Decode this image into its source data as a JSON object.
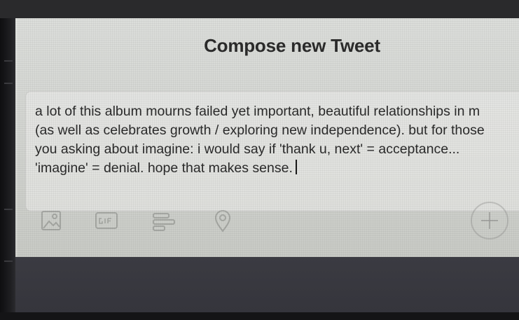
{
  "dialog": {
    "title": "Compose new Tweet"
  },
  "compose": {
    "text": "a lot of this album mourns failed yet important, beautiful relationships in m\n(as well as celebrates growth / exploring new independence). but for those\nyou asking about imagine: i would say if 'thank u, next' = acceptance...\n'imagine' = denial. hope that makes sense."
  },
  "toolbar": {
    "icons": [
      "image-icon",
      "gif-icon",
      "poll-icon",
      "location-icon",
      "add-tweet-icon"
    ]
  },
  "colors": {
    "screen_bg": "#d6d8d4",
    "text": "#2a2a2a",
    "icon": "#8a8c88",
    "bezel": "#202022",
    "bottom_panel": "#38383f"
  }
}
